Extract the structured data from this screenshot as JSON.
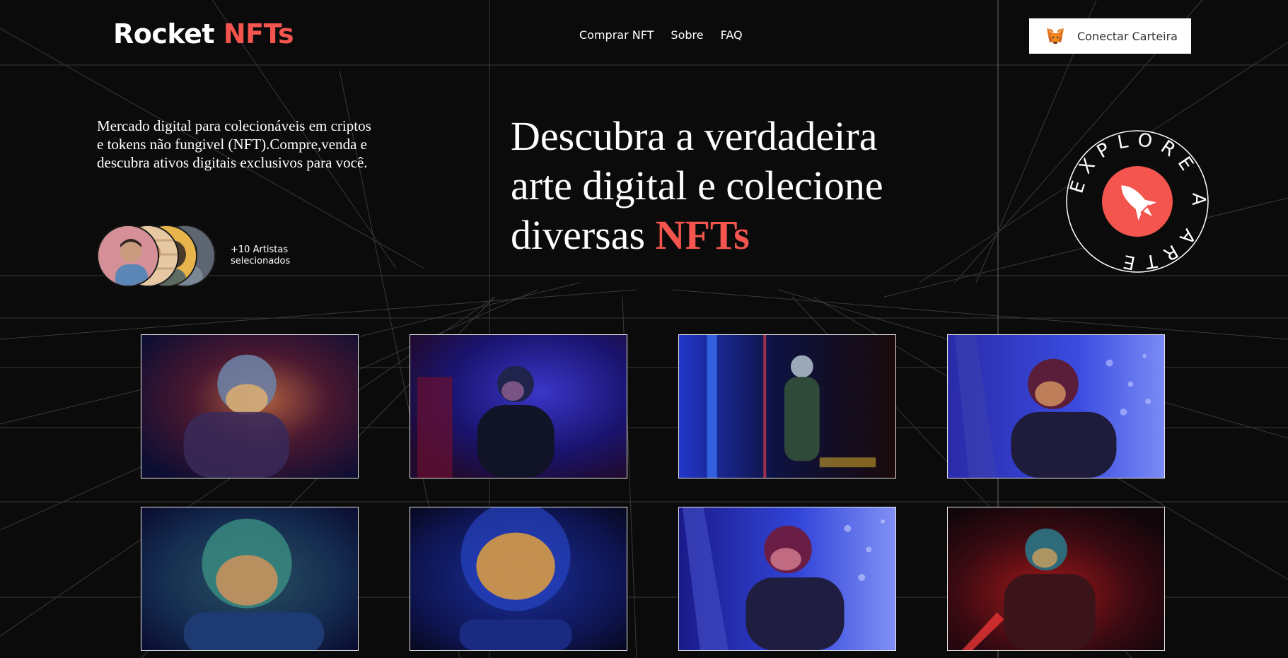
{
  "brand": {
    "name": "Rocket",
    "accent": "NFTs",
    "accent_color": "#f4554f"
  },
  "nav": {
    "items": [
      {
        "label": "Comprar NFT"
      },
      {
        "label": "Sobre"
      },
      {
        "label": "FAQ"
      }
    ]
  },
  "wallet": {
    "label": "Conectar Carteira",
    "icon": "fox-icon"
  },
  "intro": {
    "text": "Mercado digital para colecionáveis em criptos e tokens não fungivel (NFT).Compre,venda e descubra ativos digitais exclusivos para você."
  },
  "artists": {
    "label": "+10 Artistas selecionados"
  },
  "headline": {
    "line1": "Descubra a verdadeira",
    "line2": "arte digital e colecione",
    "line3_prefix": "diversas ",
    "line3_accent": "NFTs"
  },
  "explore_badge": {
    "text": "EXPLORE A ARTE",
    "icon": "rocket-icon"
  },
  "gallery": {
    "items": [
      {
        "name": "astronaut-red-blue"
      },
      {
        "name": "astronaut-blue-dark"
      },
      {
        "name": "astronaut-green-door"
      },
      {
        "name": "astronaut-blue-pattern"
      },
      {
        "name": "astronaut-teal-helmet"
      },
      {
        "name": "astronaut-gold-visor"
      },
      {
        "name": "astronaut-red-helmet-blue"
      },
      {
        "name": "astronaut-red-light"
      }
    ]
  },
  "colors": {
    "background": "#0b0b0b",
    "accent": "#f4554f",
    "grid_line": "#3a3a3a"
  }
}
